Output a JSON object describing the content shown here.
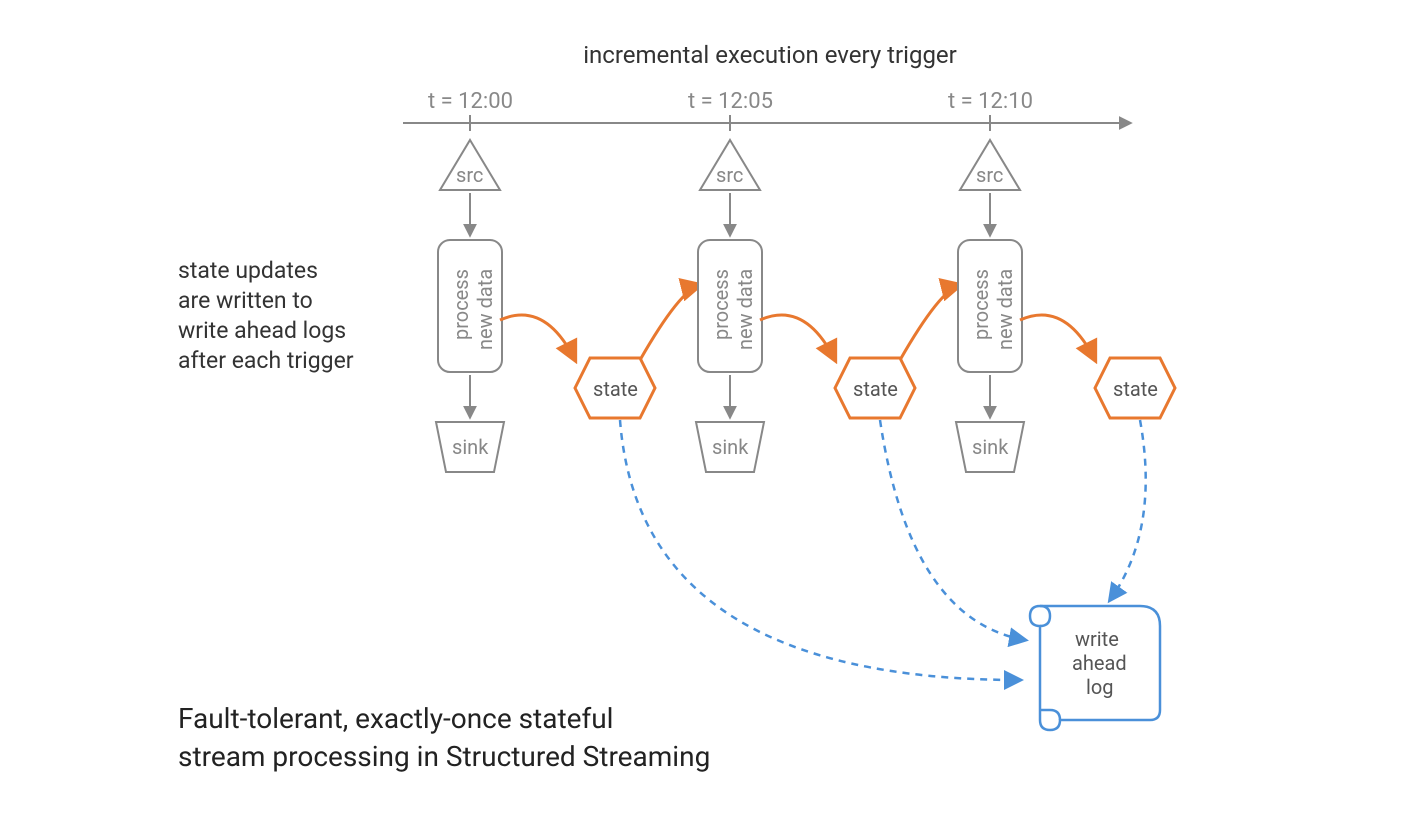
{
  "header": {
    "title": "incremental execution every trigger"
  },
  "timeline": {
    "ticks": [
      "t = 12:00",
      "t = 12:05",
      "t = 12:10"
    ]
  },
  "nodes": {
    "src": "src",
    "process_line1": "process",
    "process_line2": "new data",
    "state": "state",
    "sink": "sink"
  },
  "wal": {
    "line1": "write",
    "line2": "ahead",
    "line3": "log"
  },
  "sidecaption": {
    "line1": "state updates",
    "line2": "are written to",
    "line3": "write ahead logs",
    "line4": "after each trigger"
  },
  "bottomcaption": {
    "line1": "Fault-tolerant, exactly-once stateful",
    "line2": "stream processing in Structured Streaming"
  },
  "colors": {
    "gray": "#888888",
    "darktext": "#333333",
    "orange": "#e8782f",
    "blue": "#4a90d9"
  }
}
